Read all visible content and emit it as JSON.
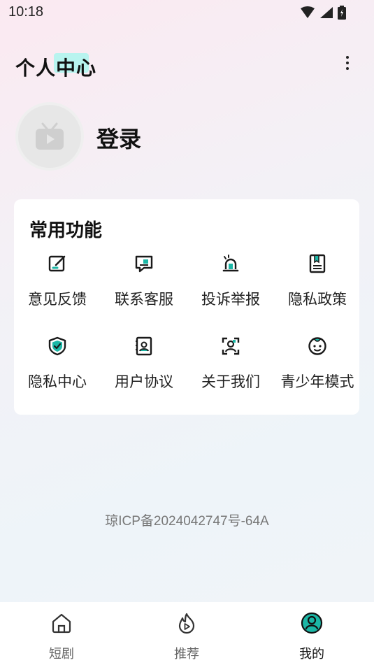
{
  "status_bar": {
    "time": "10:18"
  },
  "header": {
    "title": "个人中心"
  },
  "profile": {
    "login_label": "登录"
  },
  "functions": {
    "title": "常用功能",
    "items": [
      {
        "label": "意见反馈",
        "icon": "edit-icon"
      },
      {
        "label": "联系客服",
        "icon": "message-icon"
      },
      {
        "label": "投诉举报",
        "icon": "alarm-icon"
      },
      {
        "label": "隐私政策",
        "icon": "bookmark-book-icon"
      },
      {
        "label": "隐私中心",
        "icon": "shield-check-icon"
      },
      {
        "label": "用户协议",
        "icon": "contact-card-icon"
      },
      {
        "label": "关于我们",
        "icon": "user-scan-icon"
      },
      {
        "label": "青少年模式",
        "icon": "baby-face-icon"
      }
    ]
  },
  "footer": {
    "icp": "琼ICP备2024042747号-64A"
  },
  "tabbar": {
    "tabs": [
      {
        "label": "短剧",
        "icon": "home-icon"
      },
      {
        "label": "推荐",
        "icon": "flame-play-icon"
      },
      {
        "label": "我的",
        "icon": "profile-icon"
      }
    ],
    "active": "我的"
  },
  "colors": {
    "accent": "#1bb7a6",
    "highlight": "#b8f4ef",
    "card": "#ffffff"
  }
}
